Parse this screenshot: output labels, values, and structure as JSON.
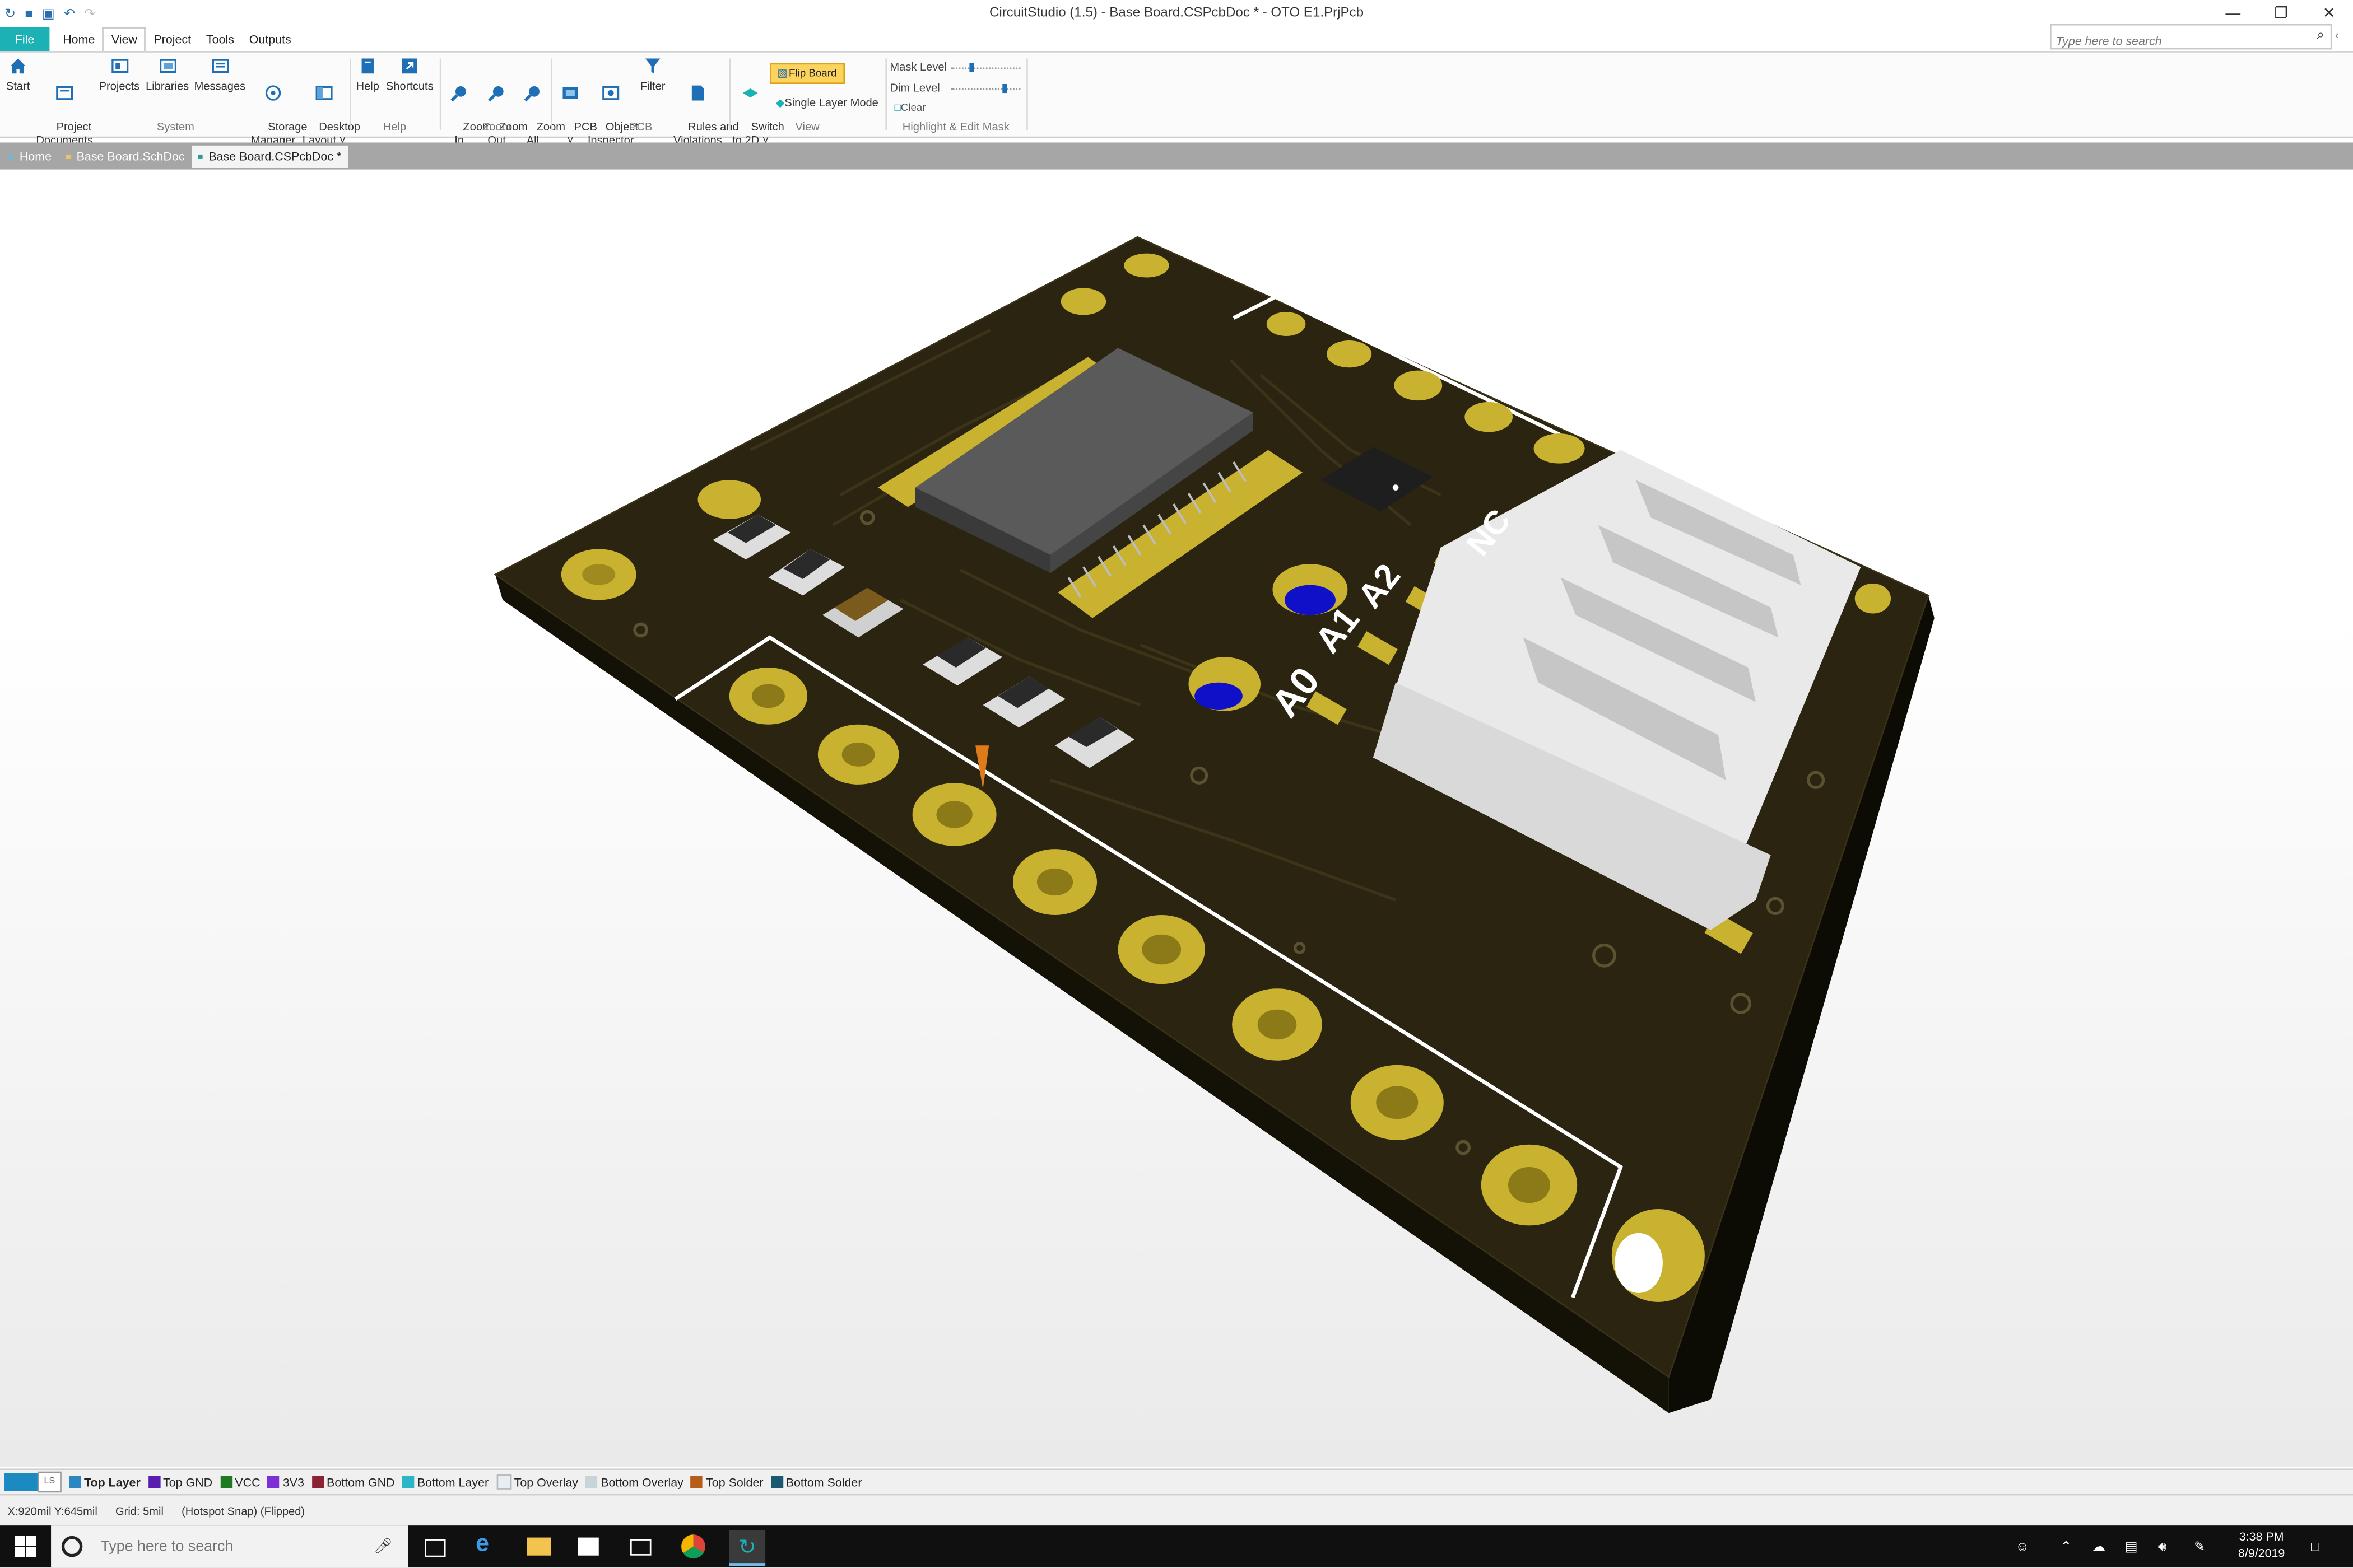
{
  "window": {
    "title": "CircuitStudio (1.5) - Base Board.CSPcbDoc * - OTO E1.PrjPcb",
    "search_placeholder": "Type here to search"
  },
  "menu": [
    "File",
    "Home",
    "View",
    "Project",
    "Tools",
    "Outputs"
  ],
  "ribbon": {
    "buttons": {
      "start": "Start",
      "project_documents": "Project\nDocuments",
      "projects": "Projects",
      "libraries": "Libraries",
      "messages": "Messages",
      "storage_manager": "Storage\nManager",
      "desktop_layout": "Desktop\nLayout ˅",
      "help": "Help",
      "shortcuts": "Shortcuts",
      "zoom_in": "Zoom\nIn",
      "zoom_out": "Zoom\nOut",
      "zoom_all": "Zoom\nAll",
      "pcb": "PCB\n˅",
      "object_inspector": "Object\nInspector",
      "filter": "Filter",
      "rules_violations": "Rules and\nViolations",
      "switch_2d": "Switch\nto 2D ˅"
    },
    "flip_board": "Flip Board",
    "single_layer_mode": "Single Layer Mode",
    "mask_level": "Mask Level",
    "dim_level": "Dim Level",
    "clear": "Clear",
    "groups": {
      "system": "System",
      "help": "Help",
      "zoom": "Zoom",
      "pcb": "PCB",
      "view": "View",
      "highlight": "Highlight & Edit Mask"
    }
  },
  "doc_tabs": [
    "Home",
    "Base Board.SchDoc",
    "Base Board.CSPcbDoc *"
  ],
  "board": {
    "silkscreen": [
      "A0",
      "A1",
      "A2",
      "NC"
    ]
  },
  "layers": [
    {
      "label": "Top Layer",
      "color": "#2e86c1",
      "active": true
    },
    {
      "label": "Top GND",
      "color": "#5a1db0"
    },
    {
      "label": "VCC",
      "color": "#1e7a1e"
    },
    {
      "label": "3V3",
      "color": "#7d2fd6"
    },
    {
      "label": "Bottom GND",
      "color": "#8b2332"
    },
    {
      "label": "Bottom Layer",
      "color": "#2bb5c5"
    },
    {
      "label": "Top Overlay",
      "color": "#e8eef2"
    },
    {
      "label": "Bottom Overlay",
      "color": "#c9d3da"
    },
    {
      "label": "Top Solder",
      "color": "#b85c1c"
    },
    {
      "label": "Bottom Solder",
      "color": "#1a5a70"
    }
  ],
  "layer_slot": "LS",
  "status": {
    "coords": "X:920mil Y:645mil",
    "grid": "Grid: 5mil",
    "snap": "(Hotspot Snap) (Flipped)"
  },
  "taskbar": {
    "search": "Type here to search",
    "time": "3:38 PM",
    "date": "8/9/2019"
  }
}
